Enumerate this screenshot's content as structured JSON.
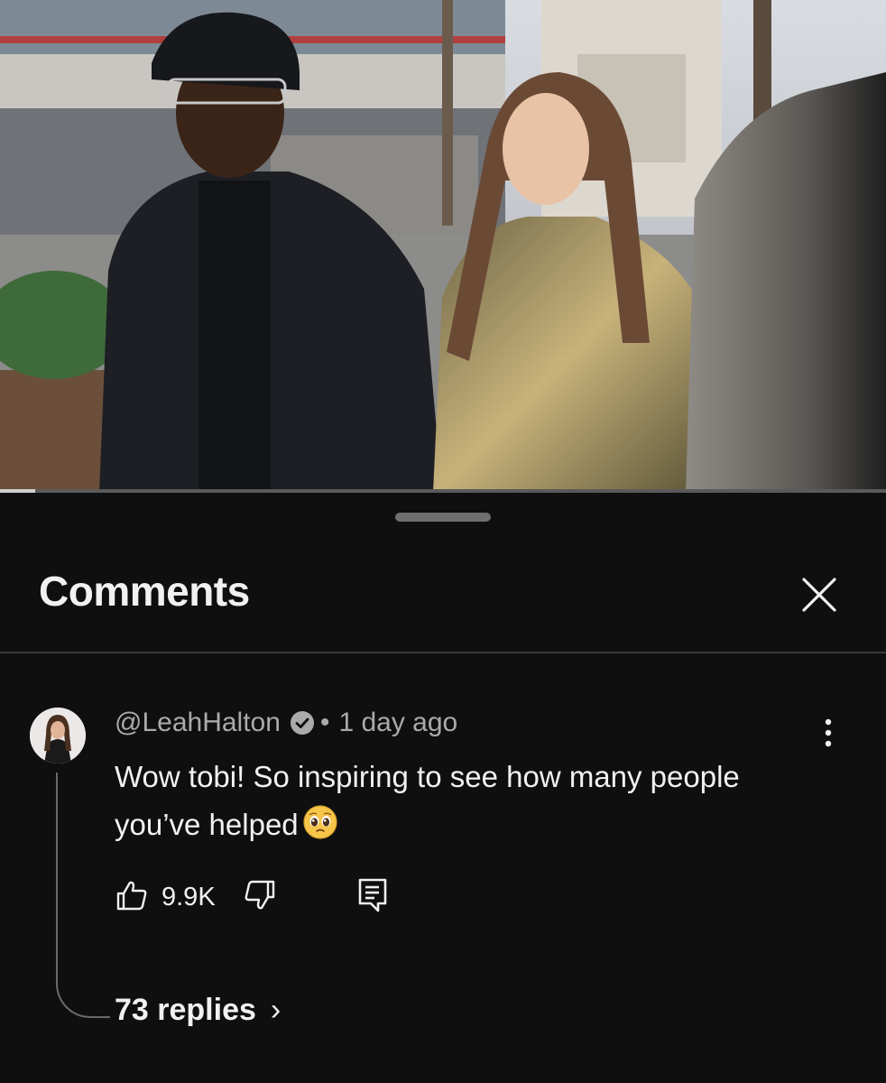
{
  "sheet": {
    "title": "Comments"
  },
  "video": {
    "progress": 0.04
  },
  "comment": {
    "author": "@LeahHalton",
    "verified": true,
    "separator": "•",
    "time": "1 day ago",
    "text": "Wow tobi! So inspiring to see how many people you’ve helped",
    "emoji": "pleading-face",
    "likes": "9.9K",
    "replies_label": "73 replies",
    "replies_chevron": "›"
  },
  "icons": {
    "close": "close-icon",
    "more": "more-vert-icon",
    "like": "thumb-up-icon",
    "dislike": "thumb-down-icon",
    "reply": "reply-comment-icon"
  }
}
